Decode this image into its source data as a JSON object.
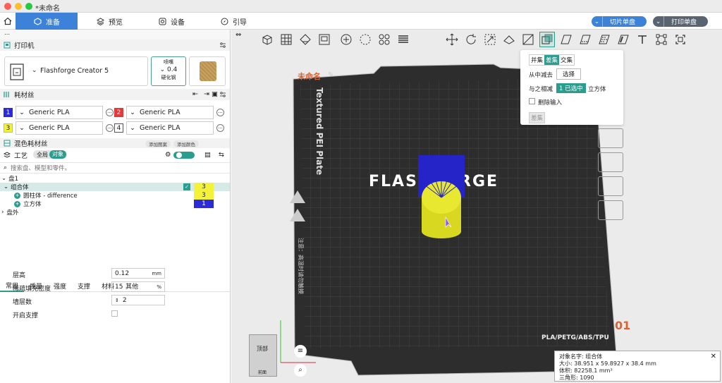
{
  "window": {
    "title": "*未命名"
  },
  "nav": {
    "tabs": [
      {
        "label": "准备",
        "active": true
      },
      {
        "label": "预览",
        "active": false
      },
      {
        "label": "设备",
        "active": false
      },
      {
        "label": "引导",
        "active": false
      }
    ],
    "slice_button": "切片单盘",
    "print_button": "打印单盘"
  },
  "printer": {
    "section_title": "打印机",
    "name": "Flashforge Creator 5",
    "nozzle_label": "喷嘴",
    "nozzle_value": "0.4",
    "nozzle_type": "硬化钢"
  },
  "filament": {
    "section_title": "耗材丝",
    "slots": [
      {
        "num": "1",
        "name": "Generic PLA",
        "color": "#2b2bd8"
      },
      {
        "num": "2",
        "name": "Generic PLA",
        "color": "#e03a3a"
      },
      {
        "num": "3",
        "name": "Generic PLA",
        "color": "#f2f23a"
      },
      {
        "num": "4",
        "name": "Generic PLA",
        "color": "#ffffff"
      }
    ]
  },
  "mix": {
    "section_title": "混色耗材丝",
    "add_pattern": "添加图案",
    "add_color": "添加颜色"
  },
  "process": {
    "section_title": "工艺",
    "toggle_global": "全局",
    "toggle_object": "对象"
  },
  "search": {
    "placeholder": "搜索盘、模型和零件。"
  },
  "tree": {
    "plate": "盘1",
    "group": "组合体",
    "group_badge": "3",
    "cylinder": "圆柱体 - difference",
    "cylinder_badge": "3",
    "cube": "立方体",
    "cube_badge": "1",
    "outside": "盘外"
  },
  "param_tabs": [
    "常用",
    "质量",
    "强度",
    "支撑",
    "材料",
    "其他"
  ],
  "params": {
    "layer_height": {
      "label": "层高",
      "value": "0.12",
      "unit": "mm"
    },
    "infill": {
      "label": "稀疏填充密度",
      "value": "15",
      "unit": "%"
    },
    "walls": {
      "label": "墙层数",
      "value": "2"
    },
    "support": {
      "label": "开启支撑"
    }
  },
  "viewport": {
    "plate_name": "未命名",
    "plate_label": "Textured PEI Plate",
    "brand": "FLASHFORGE",
    "material_text": "PLA/PETG/ABS/TPU",
    "plate_number": "01",
    "warning_cn": "注意：高温时请勿触摸",
    "cube_top": "顶部",
    "cube_front": "前面"
  },
  "boolean": {
    "ops": [
      "并集",
      "差集",
      "交集"
    ],
    "active_op": "差集",
    "subtract_from": "从中减去",
    "select_button": "选择",
    "subtract_with": "与之相减",
    "selected_count": "1 已选中",
    "selected_object": "立方体",
    "delete_input": "删除输入",
    "apply_button": "差集"
  },
  "object_info": {
    "name_label": "对象名字: 组合体",
    "size": "大小:  38.951 x 59.8927 x 38.4 mm",
    "volume": "体积:  82258.1 mm³",
    "triangles": "三角形:  1090"
  },
  "colors": {
    "accent": "#2a9d8f",
    "nav_blue": "#3b82d8"
  }
}
